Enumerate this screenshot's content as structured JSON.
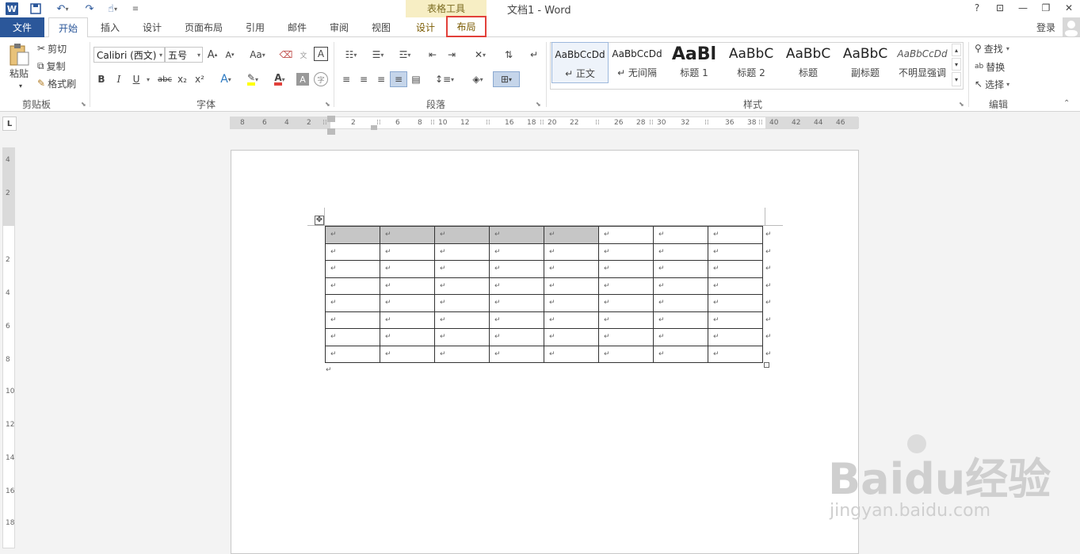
{
  "titlebar": {
    "doc_title": "文档1 - Word",
    "context_group": "表格工具",
    "help": "?",
    "options": "⊡",
    "minimize": "—",
    "restore": "❐",
    "close": "✕",
    "word_icon": "W"
  },
  "tabs": {
    "file": "文件",
    "items": [
      "开始",
      "插入",
      "设计",
      "页面布局",
      "引用",
      "邮件",
      "审阅",
      "视图"
    ],
    "ctx_design": "设计",
    "ctx_layout": "布局",
    "login": "登录"
  },
  "clipboard": {
    "paste": "粘贴",
    "cut": "剪切",
    "copy": "复制",
    "format_painter": "格式刷",
    "label": "剪贴板"
  },
  "font": {
    "name": "Calibri (西文)",
    "size": "五号",
    "grow": "A",
    "shrink": "A",
    "case": "Aa",
    "bold": "B",
    "italic": "I",
    "underline": "U",
    "strike": "abc",
    "subscript": "x₂",
    "superscript": "x²",
    "label": "字体",
    "color_accent": "#e2403a",
    "highlight_color": "#ffff00"
  },
  "paragraph": {
    "label": "段落"
  },
  "styles": {
    "items": [
      {
        "preview": "AaBbCcDd",
        "name": "↵ 正文"
      },
      {
        "preview": "AaBbCcDd",
        "name": "↵ 无间隔"
      },
      {
        "preview": "AaBl",
        "name": "标题 1"
      },
      {
        "preview": "AaBbC",
        "name": "标题 2"
      },
      {
        "preview": "AaBbC",
        "name": "标题"
      },
      {
        "preview": "AaBbC",
        "name": "副标题"
      },
      {
        "preview": "AaBbCcDd",
        "name": "不明显强调"
      }
    ],
    "label": "样式"
  },
  "editing": {
    "find": "查找",
    "replace": "替换",
    "select": "选择",
    "label": "编辑"
  },
  "ruler": {
    "h_labels": [
      "8",
      "6",
      "4",
      "2",
      "2",
      "6",
      "8",
      "10",
      "12",
      "16",
      "18",
      "20",
      "22",
      "26",
      "28",
      "30",
      "32",
      "36",
      "38",
      "40",
      "42",
      "44",
      "46"
    ],
    "v_labels": [
      "4",
      "2",
      "2",
      "4",
      "6",
      "8",
      "10",
      "12",
      "14",
      "16",
      "18"
    ],
    "tab_selector": "L"
  },
  "table": {
    "rows": 8,
    "cols": 8,
    "cell_mark": "↵",
    "selected_cells": 5
  },
  "watermark": {
    "logo": "Baidu经验",
    "url": "jingyan.baidu.com"
  },
  "colors": {
    "word_blue": "#2b579a",
    "context_tab_bg": "#f7eec4",
    "highlight_box": "#e2403a"
  }
}
